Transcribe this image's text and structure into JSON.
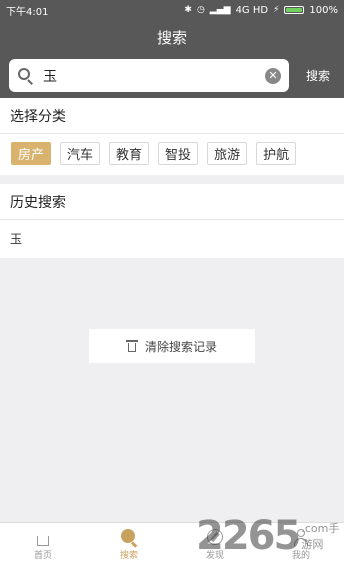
{
  "status_bar": {
    "time": "下午4:01",
    "network": "4G HD",
    "battery": "100%",
    "battery_color": "#6fd25e"
  },
  "header": {
    "title": "搜索"
  },
  "search": {
    "value": "玉",
    "button_label": "搜索",
    "cursor_color": "#d0246a"
  },
  "categories": {
    "title": "选择分类",
    "items": [
      "房产",
      "汽车",
      "教育",
      "智投",
      "旅游",
      "护航"
    ],
    "selected": "房产",
    "accent": "#d9b36e"
  },
  "history": {
    "title": "历史搜索",
    "items": [
      "玉"
    ],
    "clear_label": "清除搜索记录"
  },
  "tabbar": {
    "items": [
      {
        "label": "首页",
        "icon": "home-icon"
      },
      {
        "label": "搜索",
        "icon": "search-icon"
      },
      {
        "label": "发现",
        "icon": "discover-icon"
      },
      {
        "label": "我的",
        "icon": "user-icon"
      }
    ],
    "active": "搜索",
    "accent": "#c9a15f"
  },
  "watermark": {
    "number": "2265",
    "text": ".com手游网"
  }
}
